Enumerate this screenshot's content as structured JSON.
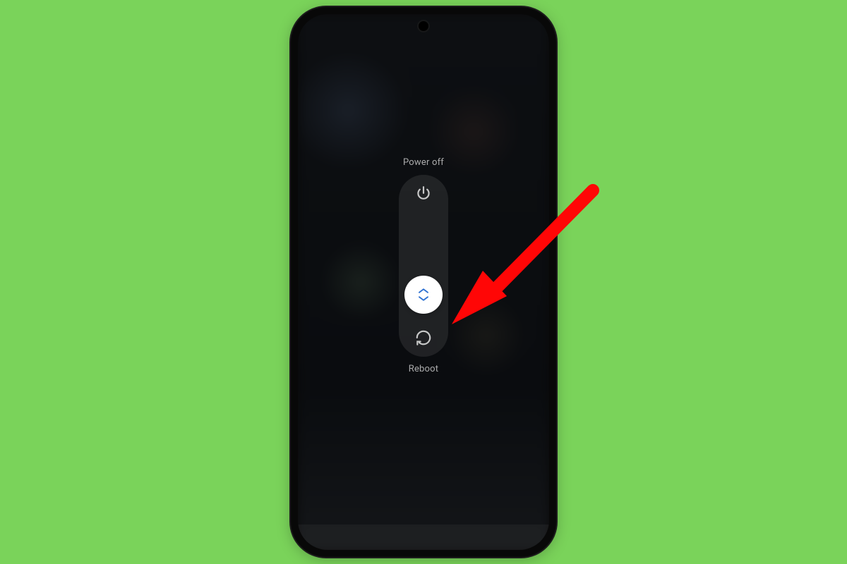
{
  "menu": {
    "power_off_label": "Power off",
    "reboot_label": "Reboot"
  },
  "icons": {
    "power": "power-icon",
    "reboot": "reboot-icon",
    "slider": "chevron-updown-icon"
  },
  "annotation": {
    "arrow_color": "#FF0606"
  },
  "colors": {
    "chevron_blue": "#2E72D2",
    "knob_white": "#FFFFFF",
    "background_green": "#7AD35A"
  }
}
